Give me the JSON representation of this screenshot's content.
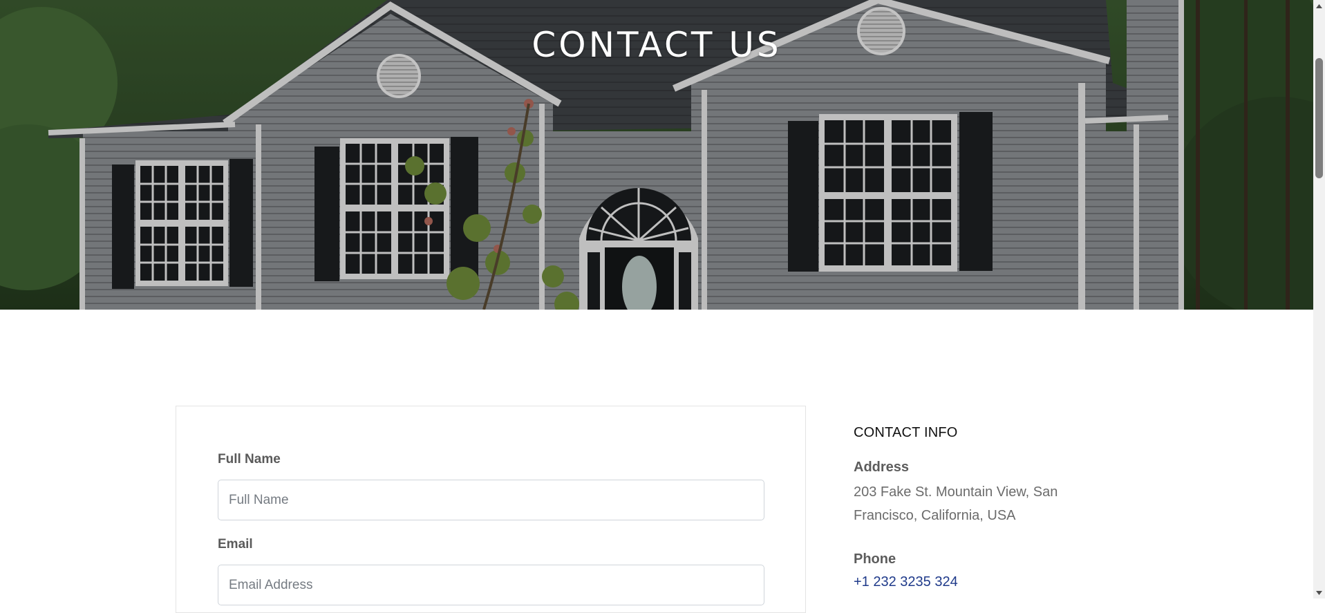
{
  "hero": {
    "title": "CONTACT US"
  },
  "form": {
    "full_name_label": "Full Name",
    "full_name_placeholder": "Full Name",
    "full_name_value": "",
    "email_label": "Email",
    "email_placeholder": "Email Address",
    "email_value": ""
  },
  "contact_info": {
    "heading": "CONTACT INFO",
    "address_label": "Address",
    "address_text": "203 Fake St. Mountain View, San Francisco, California, USA",
    "phone_label": "Phone",
    "phone_value": "+1 232 3235 324"
  },
  "icons": {
    "scroll_up": "triangle-up-icon",
    "scroll_down": "triangle-down-icon"
  },
  "colors": {
    "link": "#1f3a8a",
    "label": "#5a5a5a",
    "card_border": "#e3e3e3"
  }
}
